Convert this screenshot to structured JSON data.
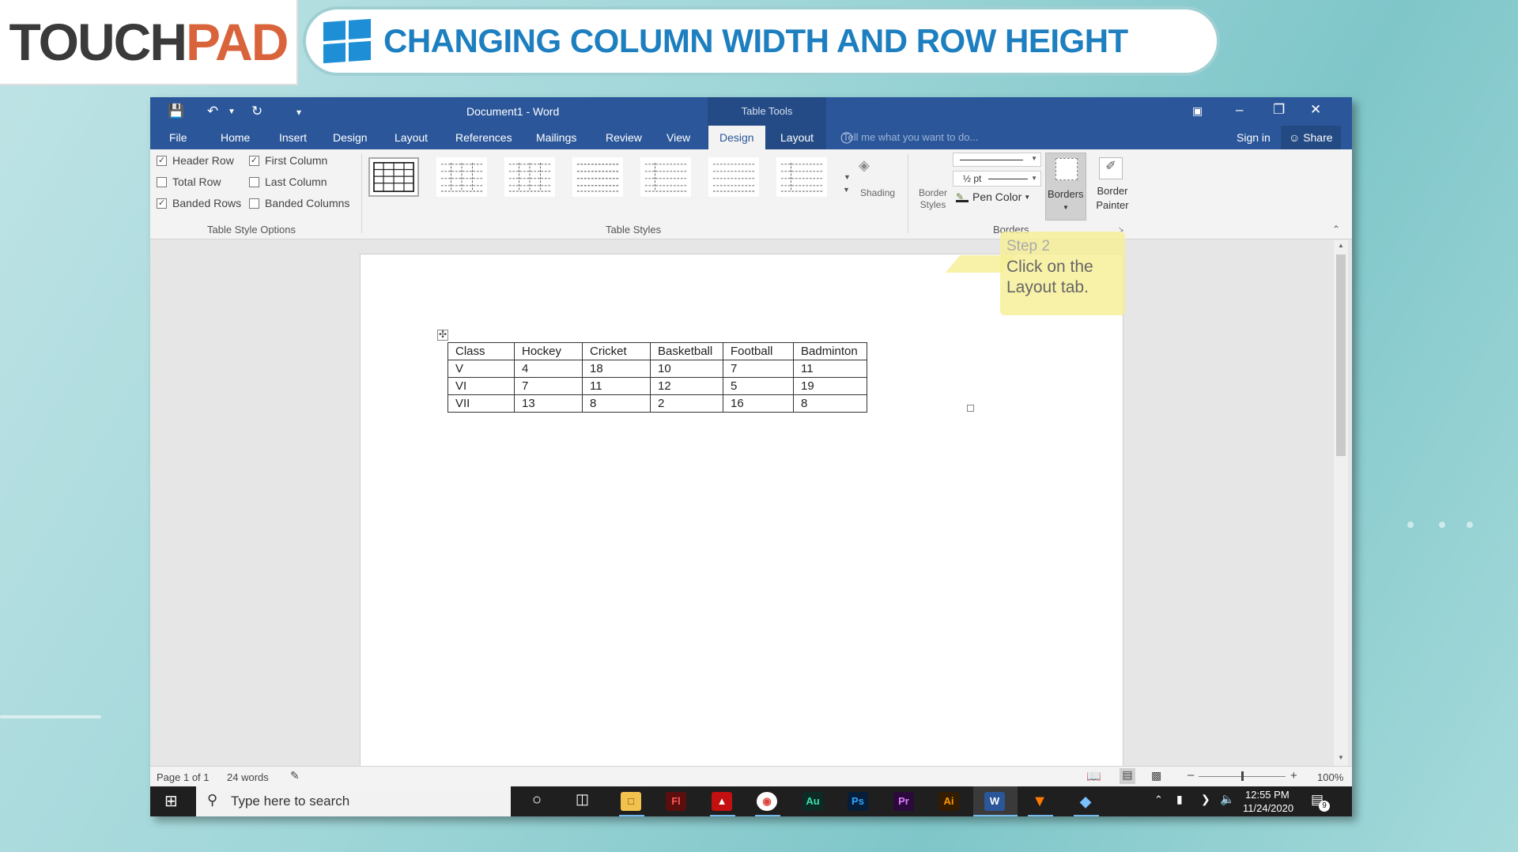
{
  "brand": {
    "logo_part1": "TOUCH",
    "logo_part2": "PAD",
    "banner_title": "CHANGING COLUMN WIDTH AND ROW HEIGHT"
  },
  "window": {
    "title": "Document1 - Word",
    "context_tab_group": "Table Tools",
    "accent": "#2b579a"
  },
  "tabs": [
    "File",
    "Home",
    "Insert",
    "Design",
    "Layout",
    "References",
    "Mailings",
    "Review",
    "View",
    "Design",
    "Layout"
  ],
  "active_tab_index": 9,
  "tell_me_placeholder": "Tell me what you want to do...",
  "account": {
    "sign_in": "Sign in",
    "share": "Share"
  },
  "table_style_options": {
    "group_label": "Table Style Options",
    "items": [
      {
        "label": "Header Row",
        "checked": true
      },
      {
        "label": "First Column",
        "checked": true
      },
      {
        "label": "Total Row",
        "checked": false
      },
      {
        "label": "Last Column",
        "checked": false
      },
      {
        "label": "Banded Rows",
        "checked": true
      },
      {
        "label": "Banded Columns",
        "checked": false
      }
    ]
  },
  "table_styles": {
    "group_label": "Table Styles",
    "shading": "Shading",
    "border_styles": "Border Styles"
  },
  "borders": {
    "group_label": "Borders",
    "weight": "½ pt",
    "pen_color": "Pen Color",
    "borders_btn": "Borders",
    "border_painter": "Border Painter"
  },
  "callout": {
    "step": "Step 2",
    "text": "Click on the Layout tab."
  },
  "doc_table": {
    "rows": [
      [
        "Class",
        "Hockey",
        "Cricket",
        "Basketball",
        "Football",
        "Badminton"
      ],
      [
        "V",
        "4",
        "18",
        "10",
        "7",
        "11"
      ],
      [
        "VI",
        "7",
        "11",
        "12",
        "5",
        "19"
      ],
      [
        "VII",
        "13",
        "8",
        "2",
        "16",
        "8"
      ]
    ]
  },
  "status": {
    "page": "Page 1 of 1",
    "words": "24 words",
    "zoom": "100%"
  },
  "taskbar": {
    "search_placeholder": "Type here to search",
    "time": "12:55 PM",
    "date": "11/24/2020",
    "notifications": "9"
  }
}
